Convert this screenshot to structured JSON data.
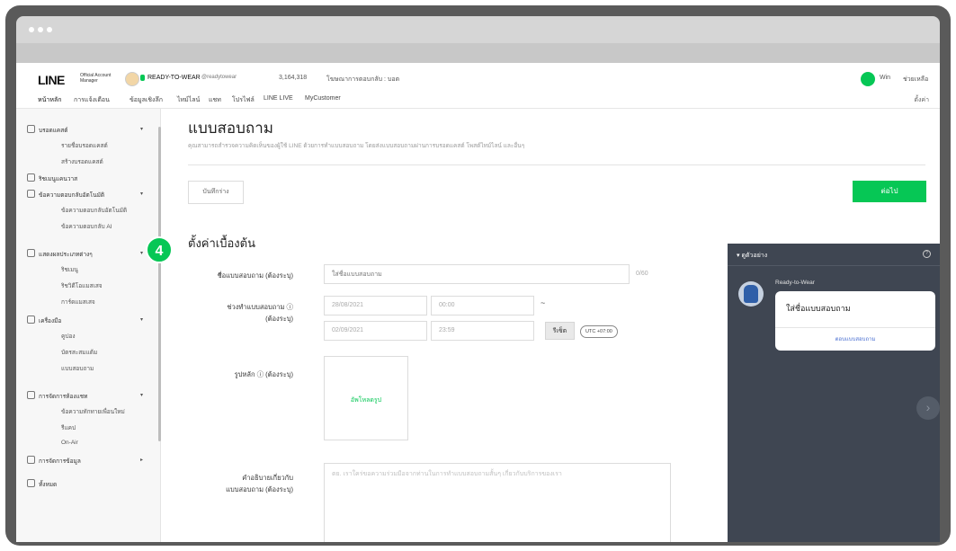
{
  "header": {
    "logo": "LINE",
    "logo_sub": "Official Account Manager",
    "account_name": "READY-TO-WEAR",
    "account_id": "@readytowear",
    "followers": "3,164,318",
    "plan": "โฆษณาการตอบกลับ : บอต",
    "user": "Win",
    "help": "ช่วยเหลือ"
  },
  "tabs": {
    "items": [
      "หน้าหลัก",
      "การแจ้งเตือน",
      "ข้อมูลเชิงลึก",
      "ไทม์ไลน์",
      "แชท",
      "โปรไฟล์",
      "LINE LIVE",
      "MyCustomer"
    ],
    "right": "ตั้งค่า"
  },
  "sidebar": {
    "broadcast": "บรอดแคสต์",
    "broadcast_list": "รายชื่อบรอดแคสต์",
    "broadcast_create": "สร้างบรอดแคสต์",
    "rich_media": "ริชเมนูแคนวาส",
    "auto_reply": "ข้อความตอบกลับอัตโนมัติ",
    "auto_reply_msg": "ข้อความตอบกลับอัตโนมัติ",
    "auto_reply_ai": "ข้อความตอบกลับ AI",
    "display": "แสดงผลประเภทต่างๆ",
    "display_1": "ริชเมนู",
    "display_2": "ริชวิดีโอแมสเสจ",
    "display_3": "การ์ดแมสเสจ",
    "tools": "เครื่องมือ",
    "tools_1": "คูปอง",
    "tools_2": "บัตรสะสมแต้ม",
    "tools_3": "แบบสอบถาม",
    "chat": "การจัดการห้องแชท",
    "chat_1": "ข้อความทักทายเพื่อนใหม่",
    "chat_2": "รีแคป",
    "chat_3": "On-Air",
    "data": "การจัดการข้อมูล",
    "more": "ทั้งหมด",
    "step_badge": "4"
  },
  "main": {
    "title": "แบบสอบถาม",
    "subtitle": "คุณสามารถสำรวจความคิดเห็นของผู้ใช้ LINE ด้วยการทำแบบสอบถาม โดยส่งแบบสอบถามผ่านการบรอดแคสต์ โพสต์ไทม์ไลน์ และอื่นๆ",
    "save_draft": "บันทึกร่าง",
    "next": "ต่อไป",
    "section": "ตั้งค่าเบื้องต้น",
    "name_label": "ชื่อแบบสอบถาม (ต้องระบุ)",
    "name_placeholder": "ใส่ชื่อแบบสอบถาม",
    "name_counter": "0/60",
    "period_label": "ช่วงทำแบบสอบถาม ⓘ",
    "period_label2": "(ต้องระบุ)",
    "start_date": "28/08/2021",
    "start_time": "00:00",
    "tilde": "~",
    "end_date": "02/09/2021",
    "end_time": "23:59",
    "reset": "รีเซ็ต",
    "utc": "UTC +07:00",
    "image_label": "รูปหลัก ⓘ (ต้องระบุ)",
    "upload": "อัพโหลดรูป",
    "desc_label": "คำอธิบายเกี่ยวกับ",
    "desc_label2": "แบบสอบถาม (ต้องระบุ)",
    "desc_placeholder": "ตย. เราใคร่ขอความร่วมมือจากท่านในการทำแบบสอบถามสั้นๆ เกี่ยวกับบริการของเรา"
  },
  "preview": {
    "title": "ดูตัวอย่าง",
    "sender": "Ready-to-Wear",
    "card_title": "ใส่ชื่อแบบสอบถาม",
    "card_button": "ตอบแบบสอบถาม",
    "next_icon": "›"
  },
  "colors": {
    "accent": "#06c755",
    "preview_bg": "#3f4652"
  }
}
